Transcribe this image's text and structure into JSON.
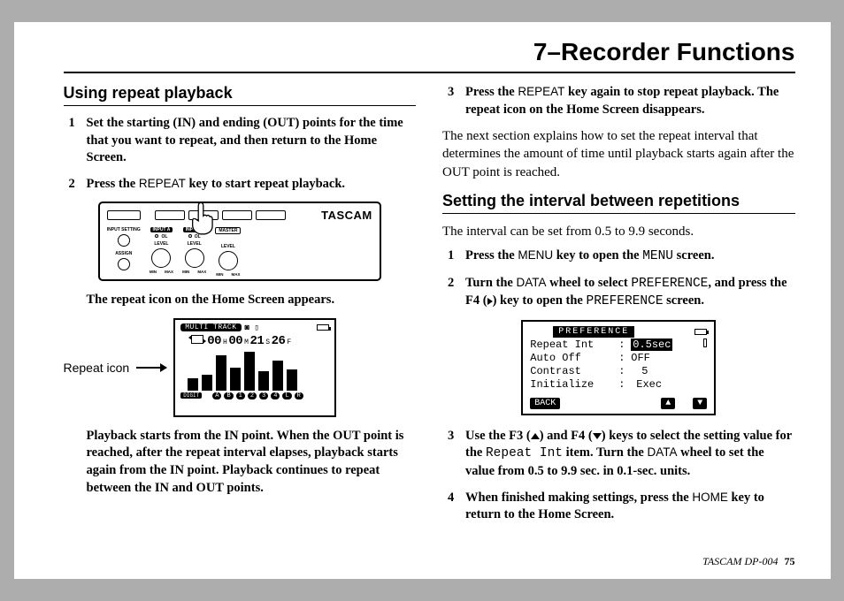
{
  "chapter": "7–Recorder Functions",
  "left": {
    "heading": "Using repeat playback",
    "step1": "Set the starting (IN) and ending (OUT) points for the time that you want to repeat, and then return to the Home Screen.",
    "step2_a": "Press the ",
    "step2_key": "REPEAT",
    "step2_b": " key to start repeat playback.",
    "device_brand": "TASCAM",
    "after_device": "The repeat icon on the Home Screen appears.",
    "repeat_label": "Repeat icon",
    "lcd": {
      "mode": "MULTI TRACK",
      "time_h": "00",
      "time_m": "00",
      "time_s": "21",
      "time_f": "26",
      "u_h": "H",
      "u_m": "M",
      "u_s": "S",
      "u_f": "F",
      "digit": "DIGIT",
      "chips": [
        "A",
        "B",
        "1",
        "2",
        "3",
        "4",
        "L",
        "R"
      ]
    },
    "after_lcd": "Playback starts from the IN point. When the OUT point is reached, after the repeat interval elapses, playback starts again from the IN point. Playback continues to repeat between the IN and OUT points."
  },
  "right": {
    "step3_a": "Press the ",
    "step3_key": "REPEAT",
    "step3_b": " key again to stop repeat playback. The repeat icon on the Home Screen disappears.",
    "para": "The next section explains how to set the repeat interval that determines the amount of time until playback starts again after the OUT point is reached.",
    "heading": "Setting the interval between repetitions",
    "intro": "The interval can be set from 0.5 to 9.9 seconds.",
    "s1_a": "Press the ",
    "s1_key": "MENU",
    "s1_b": " key to open the ",
    "s1_m": "MENU",
    "s1_c": " screen.",
    "s2_a": "Turn the ",
    "s2_key": "DATA",
    "s2_b": " wheel to select ",
    "s2_m1": "PREFERENCE",
    "s2_c": ", and press the F4 (",
    "s2_d": ") key to open the ",
    "s2_m2": "PREFERENCE",
    "s2_e": " screen.",
    "pref": {
      "title": "PREFERENCE",
      "l1k": "Repeat Int",
      "l1v": "0.5sec",
      "l2k": "Auto Off",
      "l2v": "OFF",
      "l3k": "Contrast",
      "l3v": "5",
      "l4k": "Initialize",
      "l4v": "Exec",
      "back": "BACK"
    },
    "s3_a": "Use the F3 (",
    "s3_b": ") and F4 (",
    "s3_c": ") keys to select the setting value for the ",
    "s3_m": "Repeat Int",
    "s3_d": " item. Turn the ",
    "s3_key": "DATA",
    "s3_e": " wheel to set the value from 0.5 to 9.9 sec. in 0.1-sec. units.",
    "s4_a": "When finished making settings, press the ",
    "s4_key": "HOME",
    "s4_b": " key to return to the Home Screen."
  },
  "footer": {
    "model": "TASCAM  DP-004",
    "page": "75"
  }
}
